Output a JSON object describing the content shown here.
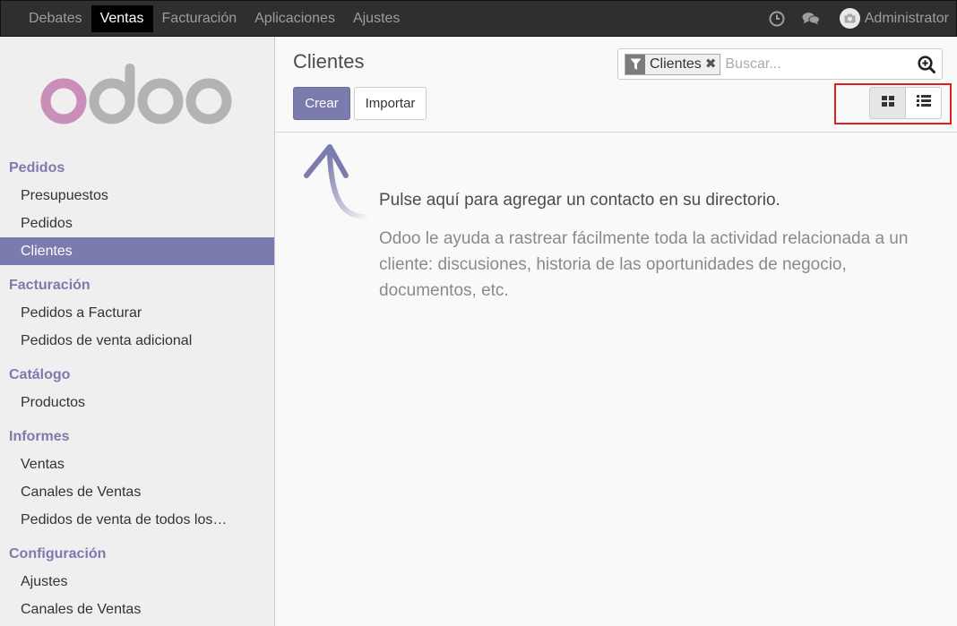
{
  "topbar": {
    "nav": [
      "Debates",
      "Ventas",
      "Facturación",
      "Aplicaciones",
      "Ajustes"
    ],
    "active": "Ventas",
    "user": "Administrator"
  },
  "logo_text": "odoo",
  "sidebar": {
    "sections": [
      {
        "title": "Pedidos",
        "items": [
          "Presupuestos",
          "Pedidos",
          "Clientes"
        ]
      },
      {
        "title": "Facturación",
        "items": [
          "Pedidos a Facturar",
          "Pedidos de venta adicional"
        ]
      },
      {
        "title": "Catálogo",
        "items": [
          "Productos"
        ]
      },
      {
        "title": "Informes",
        "items": [
          "Ventas",
          "Canales de Ventas",
          "Pedidos de venta de todos los…"
        ]
      },
      {
        "title": "Configuración",
        "items": [
          "Ajustes",
          "Canales de Ventas"
        ]
      }
    ],
    "active_item": "Clientes"
  },
  "control": {
    "title": "Clientes",
    "create_label": "Crear",
    "import_label": "Importar"
  },
  "search": {
    "facet_label": "Clientes",
    "facet_close": "✖",
    "placeholder": "Buscar..."
  },
  "help": {
    "title": "Pulse aquí para agregar un contacto en su directorio.",
    "text": "Odoo le ayuda a rastrear fácilmente toda la actividad relacionada a un cliente: discusiones, historia de las oportunidades de negocio, documentos, etc."
  },
  "colors": {
    "primary": "#7c7bad",
    "navbar": "#2f2f2f",
    "highlight_box": "#e02020"
  },
  "icons": {
    "clock": "clock-icon",
    "chat": "chat-icon",
    "avatar": "camera-icon",
    "filter": "filter-icon",
    "search": "search-zoom-icon",
    "kanban": "kanban-view-icon",
    "list": "list-view-icon",
    "arrow": "curved-arrow-icon"
  }
}
